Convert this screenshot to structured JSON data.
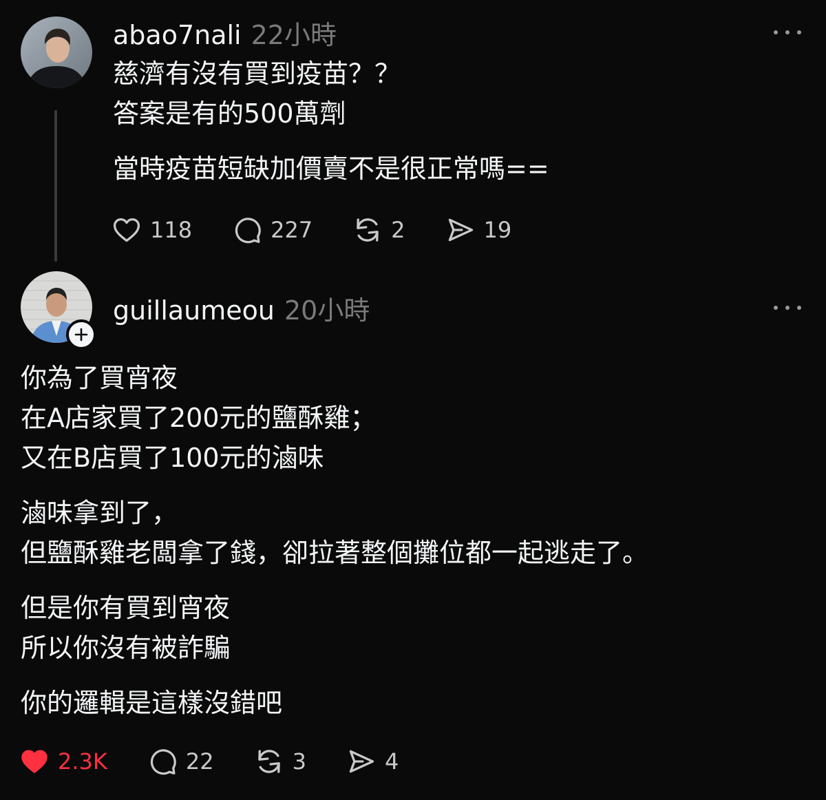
{
  "post1": {
    "username": "abao7nali",
    "timestamp": "22小時",
    "avatar_icon": "profile-photo",
    "paragraphs": [
      [
        "慈濟有沒有買到疫苗？？",
        "答案是有的500萬劑"
      ],
      [
        "當時疫苗短缺加價賣不是很正常嗎=="
      ]
    ],
    "likes": "118",
    "replies": "227",
    "reposts": "2",
    "shares": "19"
  },
  "post2": {
    "username": "guillaumeou",
    "timestamp": "20小時",
    "avatar_icon": "profile-photo",
    "follow_icon": "plus-icon",
    "paragraphs": [
      [
        "你為了買宵夜",
        "在A店家買了200元的鹽酥雞；",
        "又在B店買了100元的滷味"
      ],
      [
        "滷味拿到了，",
        "但鹽酥雞老闆拿了錢，卻拉著整個攤位都一起逃走了。"
      ],
      [
        "但是你有買到宵夜",
        "所以你沒有被詐騙"
      ],
      [
        "你的邏輯是這樣沒錯吧"
      ]
    ],
    "likes": "2.3K",
    "liked": true,
    "replies": "22",
    "reposts": "3",
    "shares": "4"
  },
  "colors": {
    "background": "#0a0a0a",
    "text": "#f3f5f7",
    "muted": "#7a7a7a",
    "like_active": "#ff3040"
  }
}
